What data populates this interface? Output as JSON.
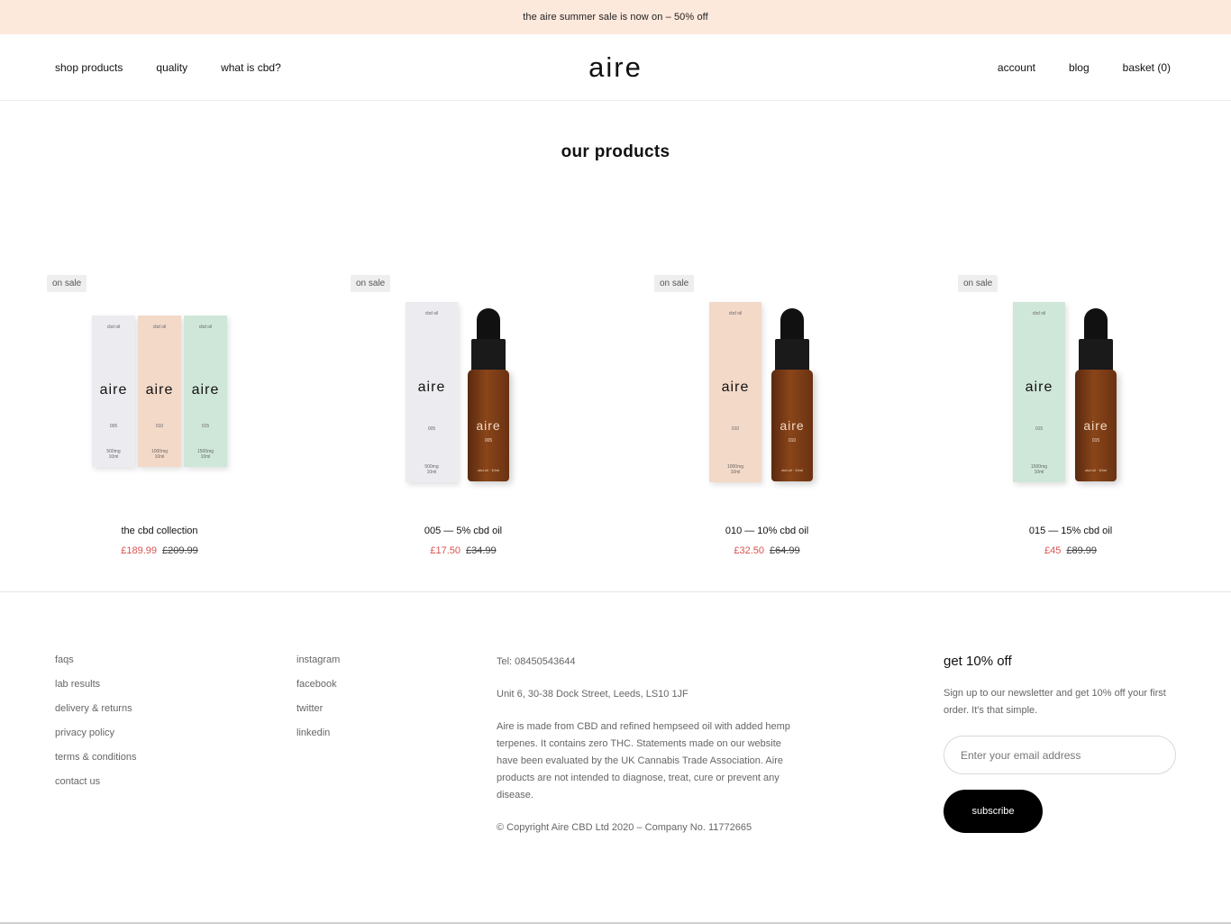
{
  "announcement": "the aire summer sale is now on – 50% off",
  "nav": {
    "left": [
      "shop products",
      "quality",
      "what is cbd?"
    ],
    "logo": "aire",
    "right": [
      "account",
      "blog",
      "basket (0)"
    ]
  },
  "page_title": "our products",
  "products": [
    {
      "badge": "on sale",
      "name": "the cbd collection",
      "sale_price": "£189.99",
      "original_price": "£209.99"
    },
    {
      "badge": "on sale",
      "name": "005 — 5% cbd oil",
      "sale_price": "£17.50",
      "original_price": "£34.99"
    },
    {
      "badge": "on sale",
      "name": "010 — 10% cbd oil",
      "sale_price": "£32.50",
      "original_price": "£64.99"
    },
    {
      "badge": "on sale",
      "name": "015 — 15% cbd oil",
      "sale_price": "£45",
      "original_price": "£89.99"
    }
  ],
  "packaging": {
    "box_top": "cbd oil",
    "brand": "aire",
    "bottle_foot": "cbd oil · 10ml",
    "boxes": [
      {
        "code": "005",
        "mg": "500mg",
        "volume": "10ml",
        "color": "#ececf0"
      },
      {
        "code": "010",
        "mg": "1000mg",
        "volume": "10ml",
        "color": "#f3d9c8"
      },
      {
        "code": "015",
        "mg": "1500mg",
        "volume": "10ml",
        "color": "#cfe7d9"
      }
    ]
  },
  "footer": {
    "links1": [
      "faqs",
      "lab results",
      "delivery & returns",
      "privacy policy",
      "terms & conditions",
      "contact us"
    ],
    "links2": [
      "instagram",
      "facebook",
      "twitter",
      "linkedin"
    ],
    "tel": "Tel: 08450543644",
    "address": "Unit 6, 30-38 Dock Street, Leeds, LS10 1JF",
    "disclaimer": "Aire is made from CBD and refined hempseed oil with added hemp terpenes. It contains zero THC. Statements made on our website have been evaluated by the UK Cannabis Trade Association. Aire products are not intended to diagnose, treat, cure or prevent any disease.",
    "copyright": "© Copyright Aire CBD Ltd 2020 – Company No. 11772665",
    "newsletter": {
      "title": "get 10% off",
      "text": "Sign up to our newsletter and get 10% off your first order. It's that simple.",
      "placeholder": "Enter your email address",
      "button": "subscribe"
    }
  },
  "colors": {
    "announcement_bg": "#fde8dc",
    "sale_price": "#d9534f",
    "button_bg": "#000000"
  }
}
